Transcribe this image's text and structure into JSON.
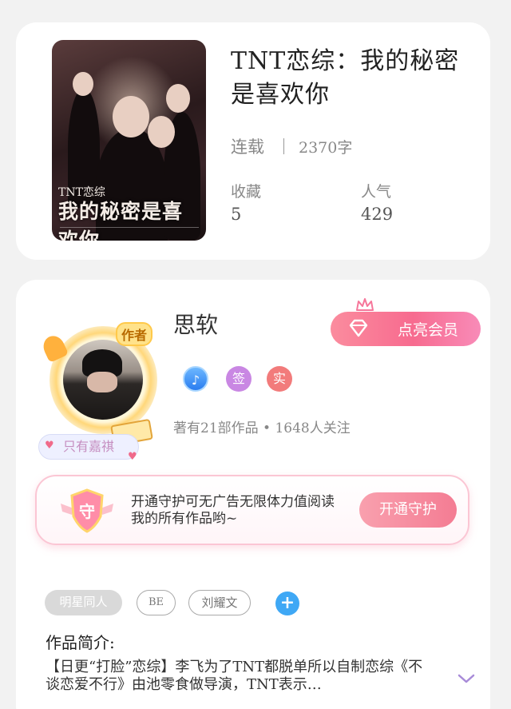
{
  "book": {
    "title": "TNT恋综：我的秘密是喜欢你",
    "cover_art_small": "TNT恋综",
    "cover_art_big": "我的秘密是喜欢你",
    "status": "连载",
    "word_count": "2370字",
    "favorites_label": "收藏",
    "favorites_value": "5",
    "popularity_label": "人气",
    "popularity_value": "429"
  },
  "author": {
    "badge": "作者",
    "name": "思软",
    "name_tag": "只有嘉祺",
    "vip_button": "点亮会员",
    "badges": {
      "sign": "签",
      "real": "实"
    },
    "meta": "著有21部作品 • 1648人关注"
  },
  "guard": {
    "text": "开通守护可无广告无限体力值阅读我的所有作品哟~",
    "shield_char": "守",
    "button": "开通守护"
  },
  "tags": [
    "明星同人",
    "BE",
    "刘耀文"
  ],
  "tag_add": "+",
  "intro": {
    "label": "作品简介:",
    "text": "【日更“打脸”恋综】李飞为了TNT都脱单所以自制恋综《不谈恋爱不行》由池零食做导演，TNT表示…"
  },
  "colors": {
    "pink": "#f76b8f",
    "blue": "#3fa8f5",
    "purple": "#c987e3",
    "red": "#f27b7b"
  }
}
